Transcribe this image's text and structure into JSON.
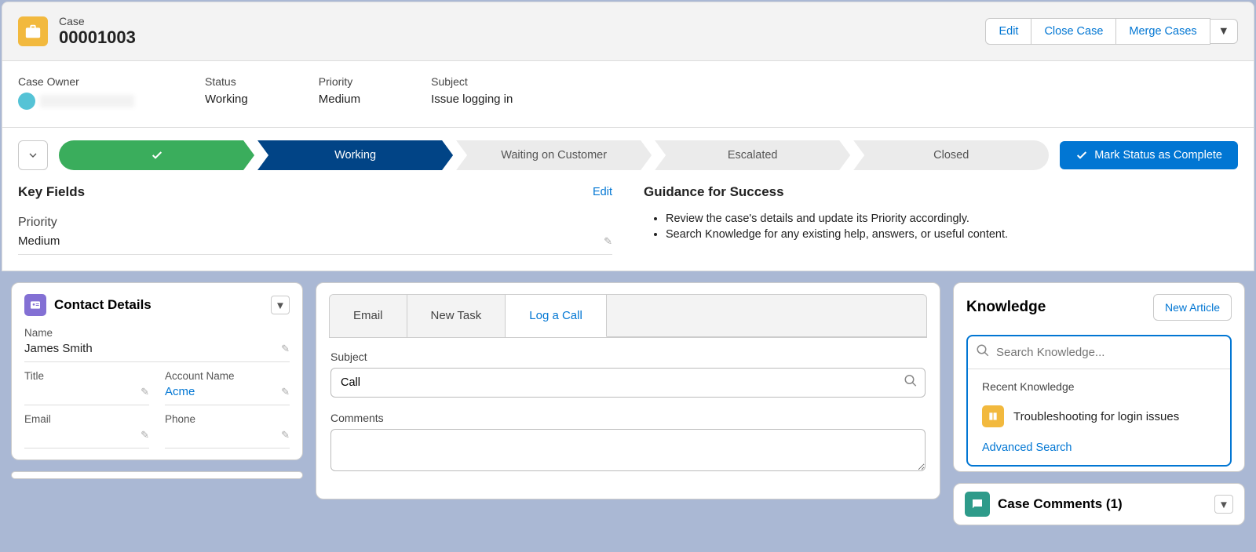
{
  "header": {
    "object_label": "Case",
    "record_number": "00001003",
    "actions": {
      "edit": "Edit",
      "close_case": "Close Case",
      "merge_cases": "Merge Cases"
    }
  },
  "highlights": {
    "owner_label": "Case Owner",
    "status_label": "Status",
    "status_value": "Working",
    "priority_label": "Priority",
    "priority_value": "Medium",
    "subject_label": "Subject",
    "subject_value": "Issue logging in"
  },
  "path": {
    "stages": [
      "",
      "Working",
      "Waiting on Customer",
      "Escalated",
      "Closed"
    ],
    "mark_complete": "Mark Status as Complete"
  },
  "key_fields": {
    "title": "Key Fields",
    "edit": "Edit",
    "priority_label": "Priority",
    "priority_value": "Medium"
  },
  "guidance": {
    "title": "Guidance for Success",
    "items": [
      "Review the case's details and update its Priority accordingly.",
      "Search Knowledge for any existing help, answers, or useful content."
    ]
  },
  "contact_details": {
    "title": "Contact Details",
    "name_label": "Name",
    "name_value": "James Smith",
    "title_label": "Title",
    "title_value": "",
    "account_label": "Account Name",
    "account_value": "Acme",
    "email_label": "Email",
    "email_value": "",
    "phone_label": "Phone",
    "phone_value": ""
  },
  "activity": {
    "tabs": {
      "email": "Email",
      "new_task": "New Task",
      "log_call": "Log a Call"
    },
    "subject_label": "Subject",
    "subject_value": "Call",
    "comments_label": "Comments"
  },
  "knowledge": {
    "title": "Knowledge",
    "new_article": "New Article",
    "search_placeholder": "Search Knowledge...",
    "recent_label": "Recent Knowledge",
    "item1": "Troubleshooting for login issues",
    "advanced": "Advanced Search"
  },
  "case_comments": {
    "title": "Case Comments (1)"
  }
}
